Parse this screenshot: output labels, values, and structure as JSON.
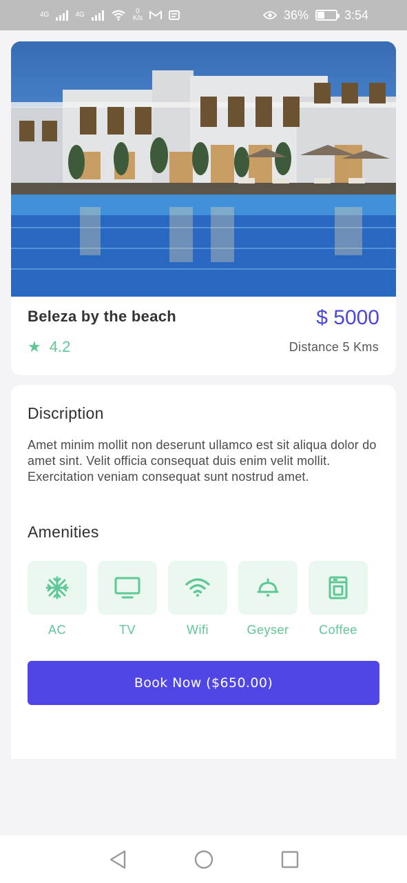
{
  "status_bar": {
    "network_1": "4G",
    "network_2": "4G",
    "speed_value": "0",
    "speed_unit": "K/s",
    "battery": "36%",
    "battery_level": 0.36,
    "time": "3:54"
  },
  "hotel": {
    "name": "Beleza by the beach",
    "price": "$ 5000",
    "rating": "4.2",
    "distance": "Distance 5 Kms"
  },
  "description": {
    "title": "Discription",
    "text": "Amet minim mollit non deserunt ullamco est sit aliqua dolor do amet sint. Velit officia consequat duis enim velit mollit. Exercitation veniam consequat sunt nostrud amet."
  },
  "amenities": {
    "title": "Amenities",
    "items": [
      {
        "label": "AC",
        "icon": "snowflake-icon"
      },
      {
        "label": "TV",
        "icon": "tv-icon"
      },
      {
        "label": "Wifi",
        "icon": "wifi-icon"
      },
      {
        "label": "Geyser",
        "icon": "geyser-icon"
      },
      {
        "label": "Coffee",
        "icon": "coffee-machine-icon"
      }
    ]
  },
  "book_button": {
    "label": "Book Now ($650.00)"
  },
  "colors": {
    "accent": "#4f46e5",
    "price": "#4a47d9",
    "green": "#5fc796",
    "amenity_bg": "#eaf8f0"
  }
}
